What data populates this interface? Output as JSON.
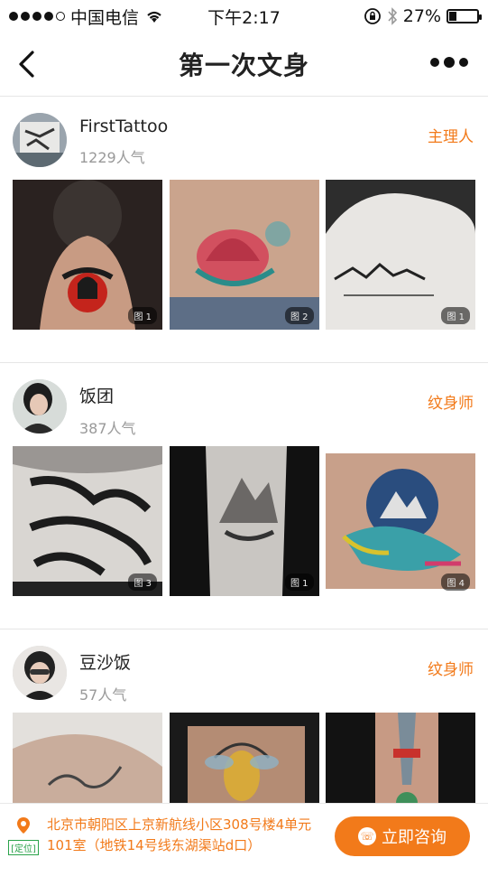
{
  "status": {
    "carrier": "中国电信",
    "time": "下午2:17",
    "battery": "27%",
    "battery_level": 0.27,
    "signal_bars": 4,
    "signal_total": 5
  },
  "nav": {
    "title": "第一次文身"
  },
  "cards": [
    {
      "name": "FirstTattoo",
      "popularity": "1229人气",
      "role": "主理人",
      "photos": [
        {
          "tag": "图 1"
        },
        {
          "tag": "图 2"
        },
        {
          "tag": "图 1"
        }
      ]
    },
    {
      "name": "饭团",
      "popularity": "387人气",
      "role": "纹身师",
      "photos": [
        {
          "tag": "图 3"
        },
        {
          "tag": "图 1"
        },
        {
          "tag": "图 4"
        }
      ]
    },
    {
      "name": "豆沙饭",
      "popularity": "57人气",
      "role": "纹身师",
      "photos": [
        {
          "tag": ""
        },
        {
          "tag": ""
        },
        {
          "tag": ""
        }
      ]
    }
  ],
  "bottom_bar": {
    "locate_label": "[定位]",
    "address": "北京市朝阳区上京新航线小区308号楼4单元101室（地铁14号线东湖渠站d口）",
    "consult_label": "立即咨询"
  },
  "colors": {
    "accent": "#f27a1a",
    "locate_green": "#2aa34a"
  }
}
